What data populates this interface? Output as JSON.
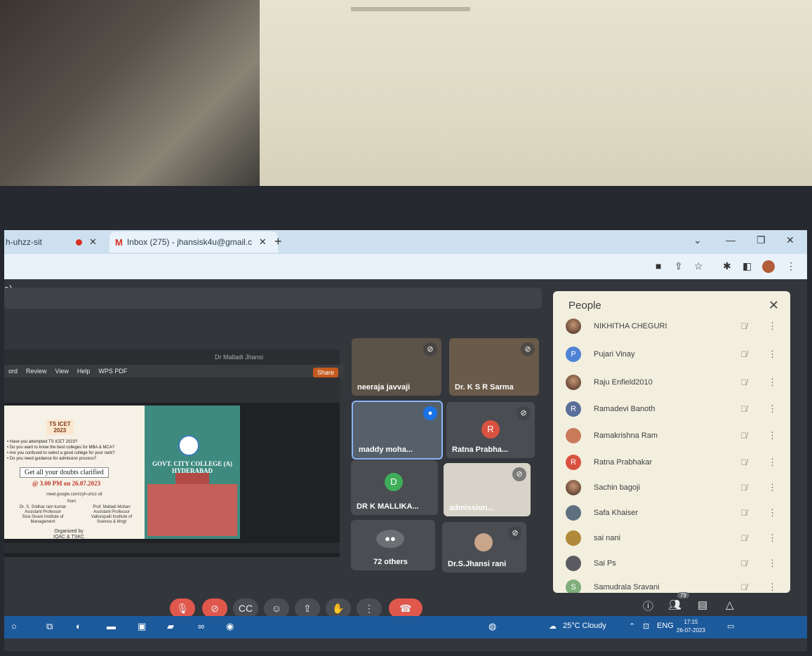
{
  "browser": {
    "tabs": [
      {
        "label": "h-uhzz-sit"
      },
      {
        "label": "Inbox (275) - jhansisk4u@gmail.c"
      }
    ],
    "new_tab": "+",
    "window_controls": [
      "⌄",
      "—",
      "❐",
      "✕"
    ]
  },
  "meet": {
    "title": "a)",
    "presentation": {
      "window_title": "Dr Malladi Jhansi",
      "menu": [
        "ord",
        "Review",
        "View",
        "Help",
        "WPS PDF"
      ],
      "share_label": "Share",
      "slide": {
        "badge": "TS ICET\n2023",
        "bullets": "• Have you attempted TS ICET 2023?\n• Do you want to know the best colleges for MBA & MCA?\n• Are you confused to select a good college for your rank?\n• Do you need guidance for admission process?",
        "doubts": "Get all your doubts clarified",
        "when": "@ 3.00 PM on 26.07.2023",
        "meet_link": "meet.google.com/zyh-uhzz-sit",
        "from": "from",
        "prof_left": "Dr. S. Sridhar ram kumar\nAssistant Professor\nSiva Sivani Institute of\nManagement",
        "prof_right": "Prof. Malladi Mohan\nAssistant Professor\nVallurupalli Institute of\nScience & Mngt",
        "org": "Organized by\nIQAC & TSKC",
        "college": "GOVT. CITY COLLEGE (A)\nHYDERABAD"
      }
    },
    "tiles": [
      {
        "name": "neeraja javvaji",
        "muted": true
      },
      {
        "name": "Dr. K S R Sarma",
        "muted": true
      },
      {
        "name": "maddy moha...",
        "muted": false
      },
      {
        "name": "Ratna Prabha...",
        "initial": "R",
        "muted": true
      },
      {
        "name": "DR K MALLIKA...",
        "initial": "D",
        "muted": false
      },
      {
        "name": "admission...",
        "muted": true
      },
      {
        "name": "72 others"
      },
      {
        "name": "Dr.S.Jhansi rani",
        "muted": true
      }
    ],
    "controls": [
      "mic-off",
      "cam-off",
      "CC",
      "emoji",
      "present",
      "hand",
      "more",
      "end-call"
    ],
    "people_panel": {
      "title": "People",
      "close": "✕",
      "participants": [
        {
          "name": "NIKHITHA CHEGURI",
          "initial": "",
          "color": "#8a6a55"
        },
        {
          "name": "Pujari Vinay",
          "initial": "P",
          "color": "#4e83d6"
        },
        {
          "name": "Raju Enfield2010",
          "initial": "",
          "color": "#8a6a55"
        },
        {
          "name": "Ramadevi Banoth",
          "initial": "R",
          "color": "#5a6e9a"
        },
        {
          "name": "Ramakrishna Ram",
          "initial": "",
          "color": "#c97a5a"
        },
        {
          "name": "Ratna Prabhakar",
          "initial": "R",
          "color": "#d9523f"
        },
        {
          "name": "Sachin bagoji",
          "initial": "",
          "color": "#6a5043"
        },
        {
          "name": "Safa Khaiser",
          "initial": "",
          "color": "#5f6f80"
        },
        {
          "name": "sai nani",
          "initial": "",
          "color": "#b08a3a"
        },
        {
          "name": "Sai Ps",
          "initial": "",
          "color": "#5a5a60"
        },
        {
          "name": "Samudrala Sravani",
          "initial": "S",
          "color": "#7fae7a"
        }
      ],
      "count": "79"
    }
  },
  "taskbar": {
    "weather": "25°C  Cloudy",
    "language": "ENG",
    "time": "17:15",
    "date": "26-07-2023"
  }
}
